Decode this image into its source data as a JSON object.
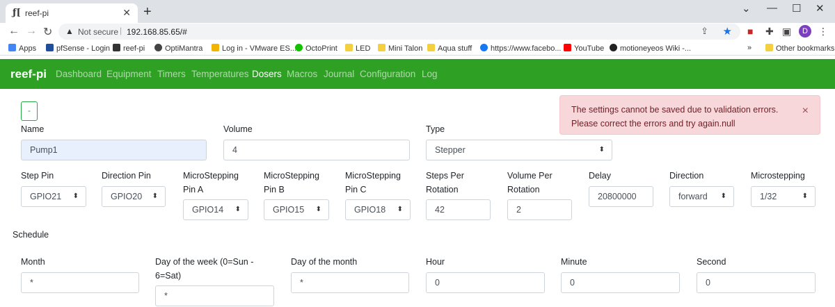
{
  "browser": {
    "tab_title": "reef-pi",
    "tab_favicon": "ƒ[",
    "security_text": "Not secure",
    "url": "192.168.85.65/#",
    "profile_initial": "D",
    "bookmarks": [
      {
        "label": "Apps",
        "color": "#4285f4"
      },
      {
        "label": "pfSense - Login",
        "color": "#1f4e9c"
      },
      {
        "label": "reef-pi",
        "color": "#333333"
      },
      {
        "label": "OptiMantra",
        "color": "#444444"
      },
      {
        "label": "Log in - VMware ES...",
        "color": "#f2b400"
      },
      {
        "label": "OctoPrint",
        "color": "#13c100"
      },
      {
        "label": "LED",
        "color": "#f4d03f"
      },
      {
        "label": "Mini Talon",
        "color": "#f4d03f"
      },
      {
        "label": "Aqua stuff",
        "color": "#f4d03f"
      },
      {
        "label": "https://www.facebo...",
        "color": "#1877f2"
      },
      {
        "label": "YouTube",
        "color": "#ff0000"
      },
      {
        "label": "motioneyeos Wiki -...",
        "color": "#222222"
      }
    ],
    "other_bookmarks": "Other bookmarks",
    "more_bookmarks": "»"
  },
  "navbar": {
    "brand": "reef-pi",
    "links": [
      "Dashboard",
      "Equipment",
      "Timers",
      "Temperatures",
      "Dosers",
      "Macros",
      "Journal",
      "Configuration",
      "Log"
    ],
    "active": "Dosers"
  },
  "toggle_label": "-",
  "alert": {
    "message": "The settings cannot be saved due to validation errors. Please correct the errors and try again.null",
    "close": "×"
  },
  "form": {
    "name_label": "Name",
    "name_value": "Pump1",
    "volume_label": "Volume",
    "volume_value": "4",
    "type_label": "Type",
    "type_value": "Stepper",
    "step_pin_label": "Step Pin",
    "step_pin_value": "GPIO21",
    "direction_pin_label": "Direction Pin",
    "direction_pin_value": "GPIO20",
    "ms_a_label": "MicroStepping Pin A",
    "ms_a_value": "GPIO14",
    "ms_b_label": "MicroStepping Pin B",
    "ms_b_value": "GPIO15",
    "ms_c_label": "MicroStepping Pin C",
    "ms_c_value": "GPIO18",
    "steps_label": "Steps Per Rotation",
    "steps_value": "42",
    "vpr_label": "Volume Per Rotation",
    "vpr_value": "2",
    "delay_label": "Delay",
    "delay_value": "20800000",
    "direction_label": "Direction",
    "direction_value": "forward",
    "microstepping_label": "Microstepping",
    "microstepping_value": "1/32"
  },
  "schedule": {
    "label": "Schedule",
    "month_label": "Month",
    "month_value": "*",
    "dow_label": "Day of the week (0=Sun - 6=Sat)",
    "dow_value": "*",
    "dom_label": "Day of the month",
    "dom_value": "*",
    "hour_label": "Hour",
    "hour_value": "0",
    "minute_label": "Minute",
    "minute_value": "0",
    "second_label": "Second",
    "second_value": "0"
  }
}
